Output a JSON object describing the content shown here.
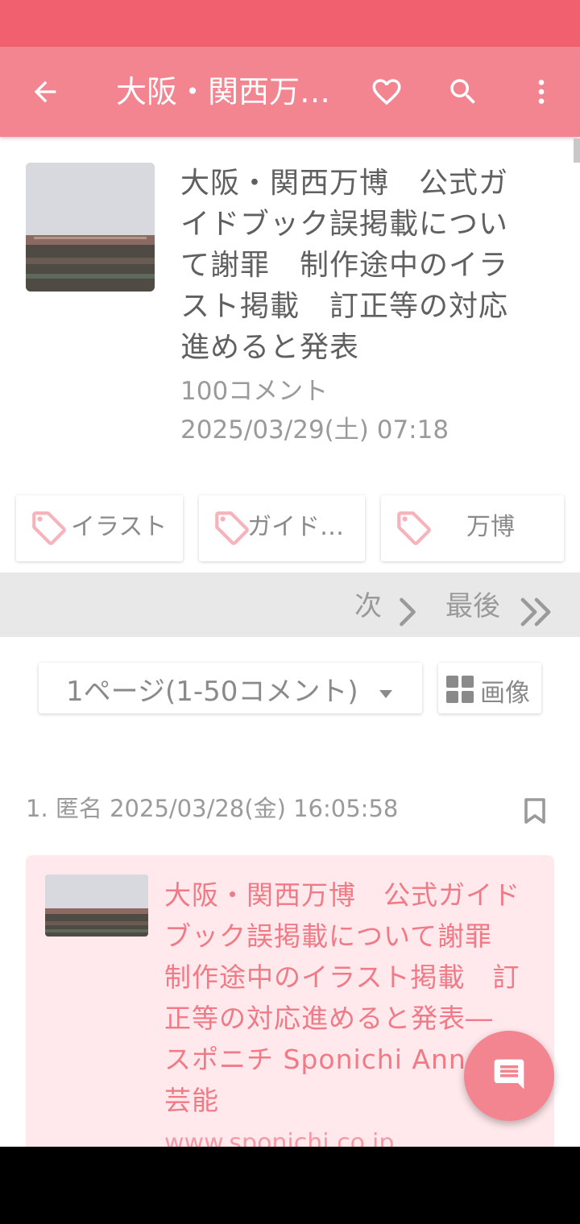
{
  "app_bar": {
    "title": "大阪・関西万博　公式ガイドブック誤掲載について謝罪"
  },
  "article": {
    "title": "大阪・関西万博　公式ガイドブック誤掲載について謝罪　制作途中のイラスト掲載　訂正等の対応進めると発表",
    "comment_count": "100コメント",
    "date": "2025/03/29(土) 07:18"
  },
  "tags": [
    {
      "label": "イラスト"
    },
    {
      "label": "ガイド…"
    },
    {
      "label": "万博"
    }
  ],
  "pager": {
    "next_label": "次",
    "last_label": "最後"
  },
  "page_select": {
    "value": "1ページ(1-50コメント)"
  },
  "image_button": {
    "label": "画像"
  },
  "comment": {
    "header": "1. 匿名 2025/03/28(金) 16:05:58",
    "link_title": "大阪・関西万博　公式ガイドブック誤掲載について謝罪　制作途中のイラスト掲載　訂正等の対応進めると発表― スポニチ Sponichi Annex 芸能",
    "link_url": "www.sponichi.co.jp"
  },
  "colors": {
    "status_bar": "#f0606e",
    "app_bar": "#f38591",
    "accent_text": "#f07a86",
    "card_bg": "#ffe9ec"
  },
  "icons": [
    "back-arrow-icon",
    "heart-icon",
    "search-icon",
    "more-vert-icon",
    "tag-icon",
    "chevron-right-icon",
    "double-chevron-right-icon",
    "dropdown-caret-icon",
    "grid-icon",
    "bookmark-icon",
    "comment-icon"
  ]
}
